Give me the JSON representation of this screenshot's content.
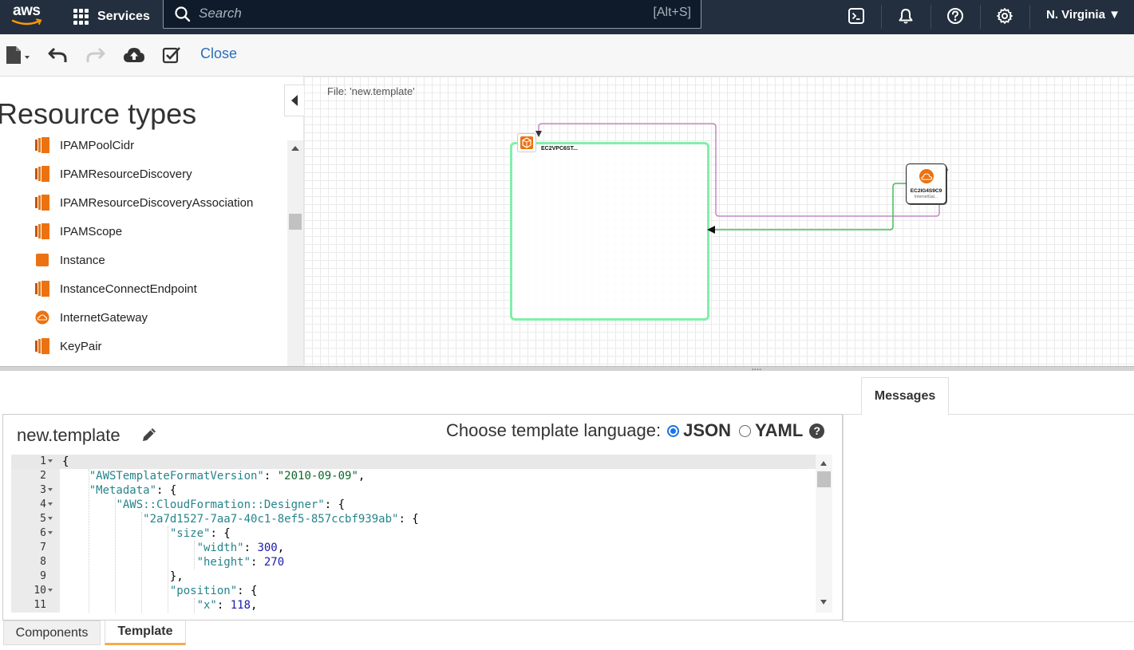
{
  "topnav": {
    "logo_text": "aws",
    "services_label": "Services",
    "search_placeholder": "Search",
    "search_shortcut": "[Alt+S]",
    "region": "N. Virginia ▼"
  },
  "toolbar": {
    "close_label": "Close"
  },
  "resource_panel": {
    "title": "Resource types",
    "items": [
      {
        "label": "IPAMPoolCidr",
        "icon": "ec2-stack-icon"
      },
      {
        "label": "IPAMResourceDiscovery",
        "icon": "ec2-stack-icon"
      },
      {
        "label": "IPAMResourceDiscoveryAssociation",
        "icon": "ec2-stack-icon"
      },
      {
        "label": "IPAMScope",
        "icon": "ec2-stack-icon"
      },
      {
        "label": "Instance",
        "icon": "instance-square-icon"
      },
      {
        "label": "InstanceConnectEndpoint",
        "icon": "ec2-stack-icon"
      },
      {
        "label": "InternetGateway",
        "icon": "cloud-circle-icon"
      },
      {
        "label": "KeyPair",
        "icon": "ec2-stack-icon"
      }
    ]
  },
  "canvas": {
    "file_label": "File: 'new.template'",
    "vpc_name": "EC2VPC6ST...",
    "igw_name": "EC2IG4S9C9",
    "igw_type": "InternetGat..."
  },
  "messages": {
    "tab_label": "Messages"
  },
  "template": {
    "name": "new.template",
    "choose_label": "Choose template language:",
    "json_label": "JSON",
    "yaml_label": "YAML",
    "help_glyph": "?",
    "lines": [
      {
        "n": "1",
        "fold": true,
        "active": true,
        "parts": [
          {
            "t": "{",
            "c": ""
          }
        ]
      },
      {
        "n": "2",
        "fold": false,
        "parts": [
          {
            "t": "    ",
            "c": ""
          },
          {
            "t": "\"AWSTemplateFormatVersion\"",
            "c": "k"
          },
          {
            "t": ": ",
            "c": ""
          },
          {
            "t": "\"2010-09-09\"",
            "c": "s"
          },
          {
            "t": ",",
            "c": ""
          }
        ]
      },
      {
        "n": "3",
        "fold": true,
        "parts": [
          {
            "t": "    ",
            "c": ""
          },
          {
            "t": "\"Metadata\"",
            "c": "k"
          },
          {
            "t": ": {",
            "c": ""
          }
        ]
      },
      {
        "n": "4",
        "fold": true,
        "parts": [
          {
            "t": "        ",
            "c": ""
          },
          {
            "t": "\"AWS::CloudFormation::Designer\"",
            "c": "k"
          },
          {
            "t": ": {",
            "c": ""
          }
        ]
      },
      {
        "n": "5",
        "fold": true,
        "parts": [
          {
            "t": "            ",
            "c": ""
          },
          {
            "t": "\"2a7d1527-7aa7-40c1-8ef5-857ccbf939ab\"",
            "c": "k"
          },
          {
            "t": ": {",
            "c": ""
          }
        ]
      },
      {
        "n": "6",
        "fold": true,
        "parts": [
          {
            "t": "                ",
            "c": ""
          },
          {
            "t": "\"size\"",
            "c": "k"
          },
          {
            "t": ": {",
            "c": ""
          }
        ]
      },
      {
        "n": "7",
        "fold": false,
        "parts": [
          {
            "t": "                    ",
            "c": ""
          },
          {
            "t": "\"width\"",
            "c": "k"
          },
          {
            "t": ": ",
            "c": ""
          },
          {
            "t": "300",
            "c": "n"
          },
          {
            "t": ",",
            "c": ""
          }
        ]
      },
      {
        "n": "8",
        "fold": false,
        "parts": [
          {
            "t": "                    ",
            "c": ""
          },
          {
            "t": "\"height\"",
            "c": "k"
          },
          {
            "t": ": ",
            "c": ""
          },
          {
            "t": "270",
            "c": "n"
          }
        ]
      },
      {
        "n": "9",
        "fold": false,
        "parts": [
          {
            "t": "                },",
            "c": ""
          }
        ]
      },
      {
        "n": "10",
        "fold": true,
        "parts": [
          {
            "t": "                ",
            "c": ""
          },
          {
            "t": "\"position\"",
            "c": "k"
          },
          {
            "t": ": {",
            "c": ""
          }
        ]
      },
      {
        "n": "11",
        "fold": false,
        "parts": [
          {
            "t": "                    ",
            "c": ""
          },
          {
            "t": "\"x\"",
            "c": "k"
          },
          {
            "t": ": ",
            "c": ""
          },
          {
            "t": "118",
            "c": "n"
          },
          {
            "t": ",",
            "c": ""
          }
        ]
      }
    ]
  },
  "bottom_tabs": {
    "components": "Components",
    "template": "Template"
  },
  "colors": {
    "nav_bg": "#232f3e",
    "vpc_border": "#7ff0a8",
    "aws_orange": "#ec7211",
    "link_blue": "#2a6ebb",
    "tab_active": "#f0ad4e"
  }
}
